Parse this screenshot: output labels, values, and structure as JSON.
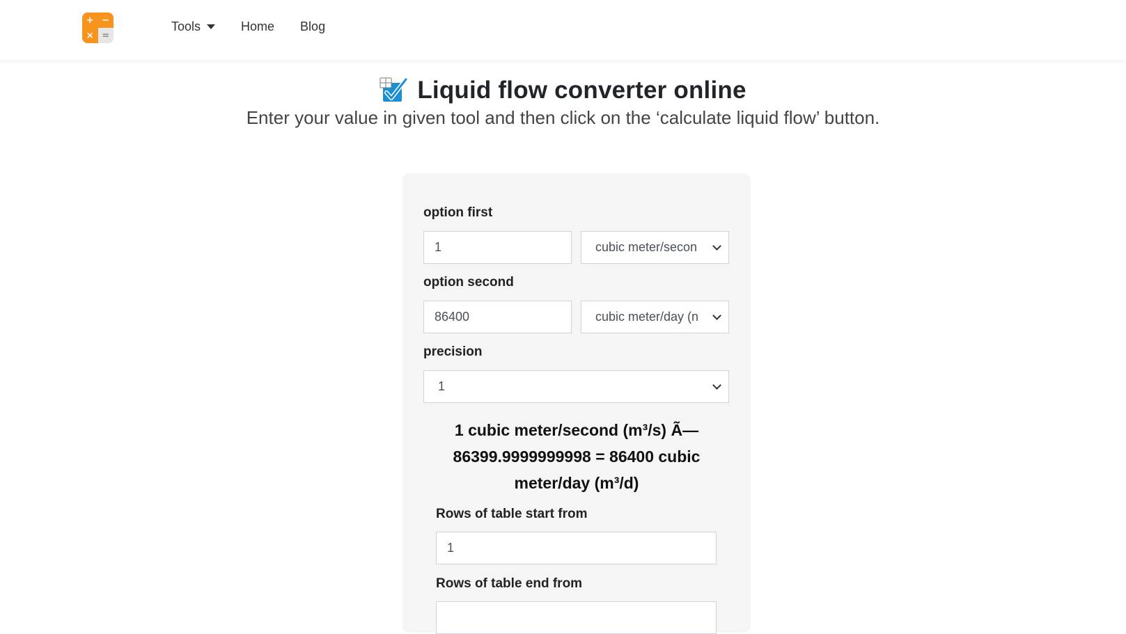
{
  "nav": {
    "logo_symbols": {
      "plus": "+",
      "minus": "−",
      "times": "×",
      "equals": "="
    },
    "tools_label": "Tools",
    "home_label": "Home",
    "blog_label": "Blog"
  },
  "header": {
    "icon": "check-box-icon",
    "title": "Liquid flow converter online",
    "subtitle": "Enter your value in given tool and then click on the ‘calculate liquid flow’ button."
  },
  "form": {
    "option_first_label": "option first",
    "option_first_value": "1",
    "option_first_unit": "cubic meter/secon",
    "option_second_label": "option second",
    "option_second_value": "86400",
    "option_second_unit": "cubic meter/day (n",
    "precision_label": "precision",
    "precision_value": "1",
    "result_line1": "1 cubic meter/second (m³/s) Ã—",
    "result_line2": "86399.9999999998 = 86400 cubic",
    "result_line3": "meter/day (m³/d)",
    "rows_start_label": "Rows of table start from",
    "rows_start_value": "1",
    "rows_end_label": "Rows of table end from",
    "rows_end_value": ""
  },
  "colors": {
    "logo_orange": "#f7941d",
    "card_background": "#f5f5f5",
    "checkbox_blue": "#1b8fd6"
  }
}
